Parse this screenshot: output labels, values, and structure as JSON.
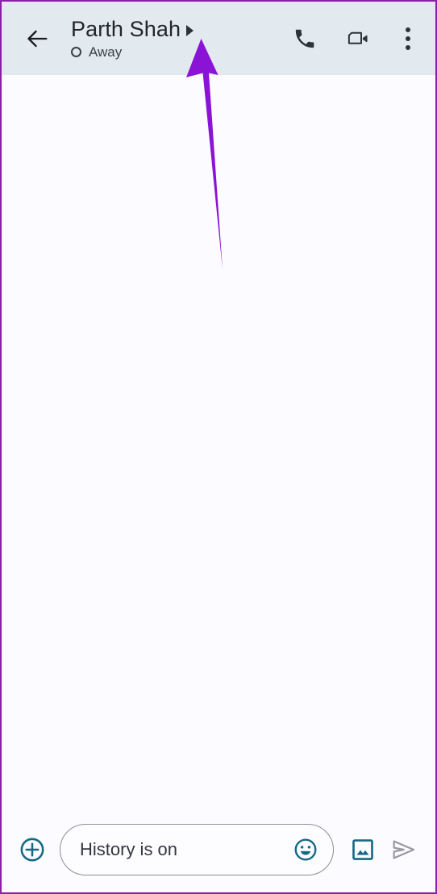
{
  "window": {
    "app": "google-chat-conversation",
    "border_color": "#8b1fa9"
  },
  "header": {
    "background": "#e2e9ef",
    "back_icon": "back-arrow-icon",
    "contact_name": "Parth Shah",
    "expand_caret": "right-caret-icon",
    "status_icon": "away-circle-icon",
    "status_text": "Away",
    "actions": [
      {
        "name": "voice-call-button",
        "icon": "phone-icon",
        "label": "Call"
      },
      {
        "name": "video-call-button",
        "icon": "video-camera-icon",
        "label": "Video call"
      },
      {
        "name": "overflow-menu-button",
        "icon": "three-dots-vertical-icon",
        "label": "More options"
      }
    ]
  },
  "conversation": {
    "background": "#fcfbff",
    "messages": []
  },
  "annotation": {
    "type": "arrow",
    "color": "#8a13d6",
    "points_to": "Parth Shah"
  },
  "compose": {
    "add_button_label": "Add",
    "add_icon": "plus-circle-icon",
    "input_value": "",
    "input_placeholder": "History is on",
    "emoji_icon": "emoji-smiley-icon",
    "gallery_icon": "image-photo-icon",
    "send_icon": "send-paper-plane-icon",
    "accent_color": "#146a84",
    "send_disabled_color": "#9a9aa2"
  }
}
